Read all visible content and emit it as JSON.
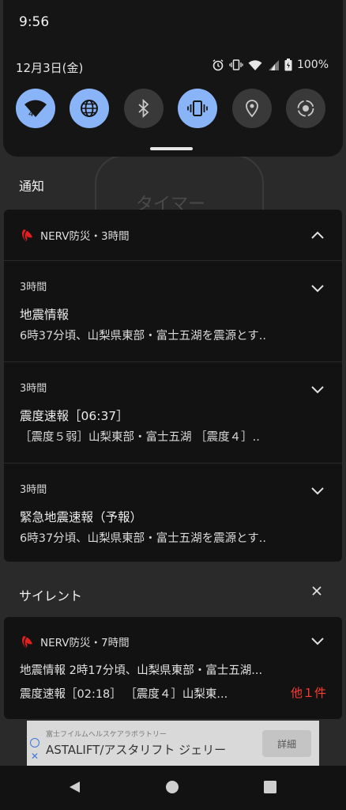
{
  "status_bar": {
    "time": "9:56"
  },
  "quick_settings": {
    "date": "12月3日(金)",
    "battery": "100%",
    "wifi_tile_badge": "4",
    "tiles": [
      {
        "icon": "wifi-icon",
        "active": true
      },
      {
        "icon": "globe-icon",
        "active": true
      },
      {
        "icon": "bluetooth-icon",
        "active": false
      },
      {
        "icon": "vibrate-icon",
        "active": true
      },
      {
        "icon": "location-icon",
        "active": false
      },
      {
        "icon": "auto-rotate-icon",
        "active": false
      }
    ]
  },
  "background_app": {
    "text": "タイマー"
  },
  "sections": {
    "notifications_title": "通知",
    "silent_title": "サイレント"
  },
  "nerv_group": {
    "header": "NERV防災・3時間",
    "items": [
      {
        "time": "3時間",
        "title": "地震情報",
        "body": "6時37分頃、山梨県東部・富士五湖を震源とす.."
      },
      {
        "time": "3時間",
        "title": "震度速報［06:37］",
        "body": "［震度５弱］山梨東部・富士五湖 ［震度４］.."
      },
      {
        "time": "3時間",
        "title": "緊急地震速報（予報）",
        "body": "6時37分頃、山梨県東部・富士五湖を震源とす.."
      }
    ]
  },
  "silent_card": {
    "header": "NERV防災・7時間",
    "line1": "地震情報 2時17分頃、山梨県東部・富士五湖...",
    "line2": "震度速報［02:18］ ［震度４］山梨東...",
    "more": "他１件"
  },
  "ad": {
    "subtitle": "富士フイルムヘルスケアラボラトリー",
    "title": "ASTALIFT/アスタリフト ジェリー",
    "button": "詳細"
  },
  "colors": {
    "accent": "#8ab4f8",
    "alert": "#ff3b30",
    "nerv_red": "#e02020"
  }
}
